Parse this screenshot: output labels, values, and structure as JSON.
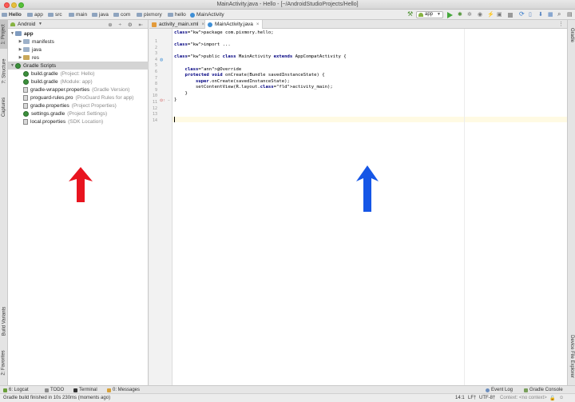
{
  "window": {
    "title": "MainActivity.java - Hello - [~/AndroidStudioProjects/Hello]"
  },
  "breadcrumbs": [
    "Hello",
    "app",
    "src",
    "main",
    "java",
    "com",
    "pixmory",
    "hello",
    "MainActivity"
  ],
  "toolbar": {
    "run_config": "app"
  },
  "left_tool_tabs": [
    "1: Project",
    "7: Structure",
    "Captures",
    "Build Variants",
    "2: Favorites"
  ],
  "right_tool_tabs": [
    "Gradle",
    "Device File Explorer"
  ],
  "project_panel": {
    "view_label": "Android",
    "tree": [
      {
        "label": "app",
        "hint": "",
        "kind": "folder-app",
        "level": 0,
        "arrow": "▼",
        "bold": true
      },
      {
        "label": "manifests",
        "hint": "",
        "kind": "folder",
        "level": 1,
        "arrow": "▶"
      },
      {
        "label": "java",
        "hint": "",
        "kind": "folder",
        "level": 1,
        "arrow": "▶"
      },
      {
        "label": "res",
        "hint": "",
        "kind": "folder-res",
        "level": 1,
        "arrow": "▶"
      },
      {
        "label": "Gradle Scripts",
        "hint": "",
        "kind": "gradle",
        "level": 0,
        "arrow": "▼",
        "selected": true
      },
      {
        "label": "build.gradle",
        "hint": "(Project: Hello)",
        "kind": "gradle",
        "level": 1
      },
      {
        "label": "build.gradle",
        "hint": "(Module: app)",
        "kind": "gradle",
        "level": 1
      },
      {
        "label": "gradle-wrapper.properties",
        "hint": "(Gradle Version)",
        "kind": "file",
        "level": 1
      },
      {
        "label": "proguard-rules.pro",
        "hint": "(ProGuard Rules for app)",
        "kind": "file",
        "level": 1
      },
      {
        "label": "gradle.properties",
        "hint": "(Project Properties)",
        "kind": "file",
        "level": 1
      },
      {
        "label": "settings.gradle",
        "hint": "(Project Settings)",
        "kind": "gradle",
        "level": 1
      },
      {
        "label": "local.properties",
        "hint": "(SDK Location)",
        "kind": "file",
        "level": 1
      }
    ]
  },
  "editor": {
    "tabs": [
      {
        "label": "activity_main.xml",
        "active": false
      },
      {
        "label": "MainActivity.java",
        "active": true
      }
    ],
    "line_numbers": [
      "1",
      "2",
      "3",
      "4",
      "5",
      "6",
      "7",
      "8",
      "9",
      "10",
      "11",
      "12",
      "13",
      "14"
    ],
    "code": [
      "package com.pixmory.hello;",
      "",
      "import ...",
      "",
      "public class MainActivity extends AppCompatActivity {",
      "",
      "    @Override",
      "    protected void onCreate(Bundle savedInstanceState) {",
      "        super.onCreate(savedInstanceState);",
      "        setContentView(R.layout.activity_main);",
      "    }",
      "}",
      "",
      ""
    ]
  },
  "bottom_tool_tabs": [
    "6: Logcat",
    "TODO",
    "Terminal",
    "0: Messages"
  ],
  "bottom_right_tabs": [
    "Event Log",
    "Gradle Console"
  ],
  "status": {
    "message": "Gradle build finished in 10s 230ms (moments ago)",
    "position": "14:1",
    "line_sep": "LF†",
    "encoding": "UTF-8†",
    "context": "Context: <no context>"
  },
  "annotations": {
    "left_arrow_color": "#e8141f",
    "right_arrow_color": "#1656e6"
  }
}
